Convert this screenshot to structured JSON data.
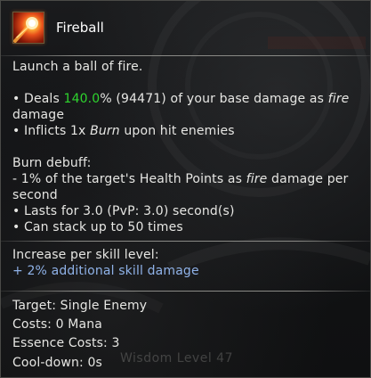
{
  "skill": {
    "name": "Fireball",
    "icon": "fireball-icon",
    "description": "Launch a ball of fire."
  },
  "effects": {
    "deals_prefix": "• Deals ",
    "deals_percent": "140.0",
    "deals_suffix": "% (94471) of your base damage as ",
    "deals_type": "fire",
    "deals_wrap": "damage",
    "inflicts_prefix": "• Inflicts 1x ",
    "inflicts_status": "Burn",
    "inflicts_suffix": " upon hit enemies"
  },
  "burn": {
    "heading": "Burn debuff:",
    "line1_prefix": "- 1% of the target's Health Points as ",
    "line1_type": "fire",
    "line1_suffix": " damage per",
    "line1_wrap": "second",
    "lasts": "• Lasts for 3.0 (PvP: 3.0) second(s)",
    "stack": "• Can stack up to 50 times"
  },
  "per_level": {
    "heading": "Increase per skill level:",
    "bonus": "+ 2% additional skill damage"
  },
  "stats": {
    "target": "Target: Single Enemy",
    "costs": "Costs: 0 Mana",
    "essence": "Essence Costs: 3",
    "cooldown": "Cool-down: 0s"
  },
  "background_text": "Wisdom  Level 47",
  "colors": {
    "highlight_green": "#2ed52e",
    "per_level_blue": "#8fb2e8",
    "text": "#e6e6e3"
  }
}
